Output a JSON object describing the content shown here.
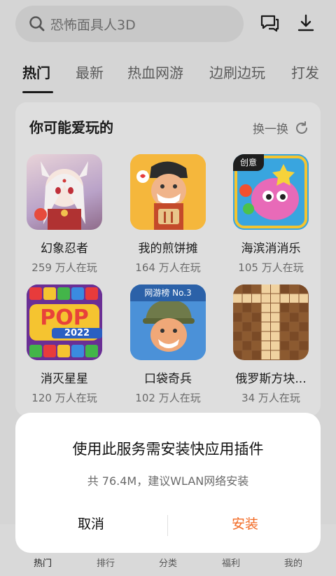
{
  "search": {
    "placeholder": "恐怖面具人3D",
    "icon": "search-icon"
  },
  "top_actions": [
    {
      "icon": "message-icon"
    },
    {
      "icon": "download-icon"
    }
  ],
  "tabs": [
    {
      "label": "热门",
      "active": true
    },
    {
      "label": "最新"
    },
    {
      "label": "热血网游"
    },
    {
      "label": "边刷边玩"
    },
    {
      "label": "打发"
    }
  ],
  "recommend": {
    "title": "你可能爱玩的",
    "refresh_label": "换一换",
    "games": [
      {
        "name": "幻象忍者",
        "players": "259 万人在玩"
      },
      {
        "name": "我的煎饼摊",
        "players": "164 万人在玩"
      },
      {
        "name": "海滨消消乐",
        "players": "105 万人在玩",
        "badge": "创意"
      },
      {
        "name": "消灭星星",
        "players": "120 万人在玩",
        "art_text": "POP",
        "art_year": "2022"
      },
      {
        "name": "口袋奇兵",
        "players": "102 万人在玩",
        "banner": "网游榜 No.3"
      },
      {
        "name": "俄罗斯方块...",
        "players": "34 万人在玩"
      }
    ]
  },
  "bottom_nav": [
    {
      "label": "热门",
      "active": true
    },
    {
      "label": "排行"
    },
    {
      "label": "分类"
    },
    {
      "label": "福利"
    },
    {
      "label": "我的"
    }
  ],
  "dialog": {
    "title": "使用此服务需安装快应用插件",
    "subtitle": "共 76.4M，建议WLAN网络安装",
    "cancel_label": "取消",
    "install_label": "安装",
    "install_color": "#f26a24"
  }
}
